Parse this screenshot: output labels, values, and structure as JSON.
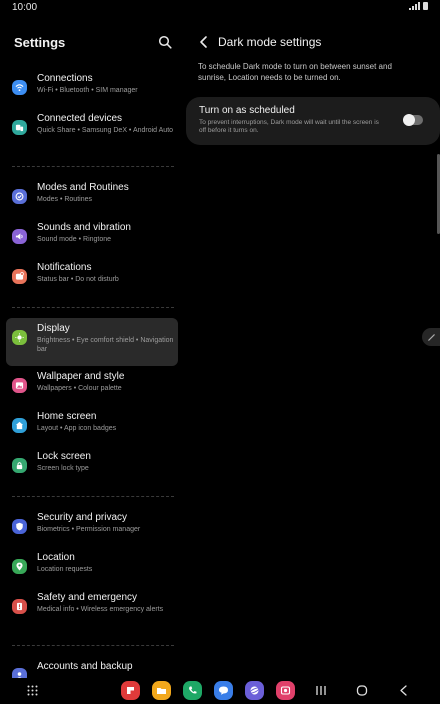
{
  "status_bar": {
    "time": "10:00"
  },
  "left_pane": {
    "title": "Settings",
    "groups": [
      [
        {
          "title": "Connections",
          "subtitle": "Wi-Fi  •  Bluetooth  •  SIM manager",
          "icon": "wifi-icon",
          "color": "#3d8ef2"
        },
        {
          "title": "Connected devices",
          "subtitle": "Quick Share  •  Samsung DeX  •  Android Auto",
          "icon": "connected-devices-icon",
          "color": "#2fa89c"
        }
      ],
      [
        {
          "title": "Modes and Routines",
          "subtitle": "Modes  •  Routines",
          "icon": "modes-routines-icon",
          "color": "#5a6fd8"
        },
        {
          "title": "Sounds and vibration",
          "subtitle": "Sound mode  •  Ringtone",
          "icon": "sound-icon",
          "color": "#8a63d6"
        },
        {
          "title": "Notifications",
          "subtitle": "Status bar  •  Do not disturb",
          "icon": "notifications-icon",
          "color": "#e8735a"
        }
      ],
      [
        {
          "title": "Display",
          "subtitle": "Brightness  •  Eye comfort shield  •  Navigation bar",
          "icon": "display-icon",
          "color": "#7bbf3c",
          "selected": true
        },
        {
          "title": "Wallpaper and style",
          "subtitle": "Wallpapers  •  Colour palette",
          "icon": "wallpaper-icon",
          "color": "#e0558a"
        },
        {
          "title": "Home screen",
          "subtitle": "Layout  •  App icon badges",
          "icon": "home-screen-icon",
          "color": "#2f9fd8"
        },
        {
          "title": "Lock screen",
          "subtitle": "Screen lock type",
          "icon": "lock-icon",
          "color": "#35a870"
        }
      ],
      [
        {
          "title": "Security and privacy",
          "subtitle": "Biometrics  •  Permission manager",
          "icon": "security-icon",
          "color": "#4a64d8"
        },
        {
          "title": "Location",
          "subtitle": "Location requests",
          "icon": "location-icon",
          "color": "#38a858"
        },
        {
          "title": "Safety and emergency",
          "subtitle": "Medical info  •  Wireless emergency alerts",
          "icon": "emergency-icon",
          "color": "#d8504a"
        }
      ],
      [
        {
          "title": "Accounts and backup",
          "subtitle": "",
          "icon": "accounts-icon",
          "color": "#5a6fd8"
        }
      ]
    ]
  },
  "right_pane": {
    "title": "Dark mode settings",
    "description": "To schedule Dark mode to turn on between sunset and sunrise, Location needs to be turned on.",
    "option": {
      "title": "Turn on as scheduled",
      "subtitle": "To prevent interruptions, Dark mode will wait until the screen is off before it turns on.",
      "enabled": false
    }
  },
  "nav_bar": {
    "dock_apps": [
      {
        "icon": "flipboard-icon",
        "color": "#e03a3a"
      },
      {
        "icon": "my-files-icon",
        "color": "#f2a81c"
      },
      {
        "icon": "phone-icon",
        "color": "#1ea866"
      },
      {
        "icon": "messages-icon",
        "color": "#3a7ee8"
      },
      {
        "icon": "internet-icon",
        "color": "#6b5fd8"
      },
      {
        "icon": "screen-recorder-icon",
        "color": "#e0406a"
      }
    ]
  }
}
